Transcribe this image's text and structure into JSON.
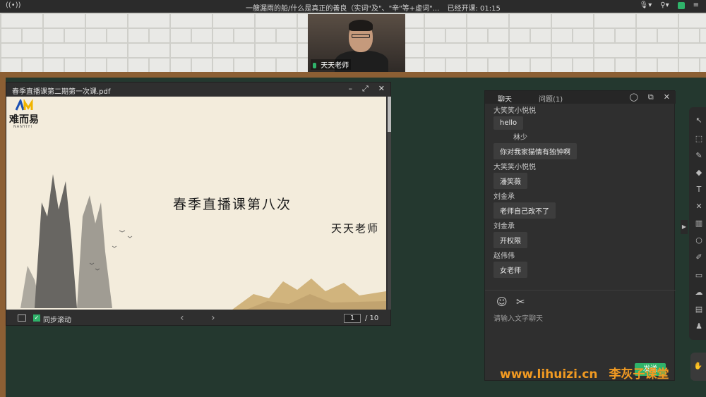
{
  "topbar": {
    "title": "一艘漏雨的船/什么是真正的善良（实词\"及\"、\"辛\"等+虚词\"...",
    "status": "已经开课: 01:15",
    "signal_icon": "broadcast-icon",
    "mic_icon": "microphone-icon",
    "location_icon": "location-icon"
  },
  "video": {
    "name": "天天老师"
  },
  "pdf": {
    "title": "春季直播课第二期第一次课.pdf",
    "slide": {
      "logo_text": "难而易",
      "logo_sub": "NANYIYI",
      "title": "春季直播课第八次",
      "teacher": "天天老师"
    },
    "sync_label": "同步滚动",
    "page_current": "1",
    "page_total": "/ 10"
  },
  "chat": {
    "tab_chat": "聊天",
    "tab_questions": "问题(1)",
    "messages": [
      {
        "sender": "大笑笑小悦悦",
        "text": "hello"
      },
      {
        "sender": "林少",
        "text": "你对我家猫情有独钟啊"
      },
      {
        "sender": "大笑笑小悦悦",
        "text": "潘笑薇"
      },
      {
        "sender": "刘金承",
        "text": "老师自己改不了"
      },
      {
        "sender": "刘金承",
        "text": "开权限"
      },
      {
        "sender": "赵伟伟",
        "text": "女老师"
      }
    ],
    "input_placeholder": "请输入文字聊天",
    "send_label": "发送"
  },
  "watermark": {
    "url": "www.lihuizi.cn",
    "brand": "李灰子课堂"
  },
  "colors": {
    "board": "#24382f",
    "frame": "#8c5f34",
    "accent_green": "#2fb36a",
    "watermark_orange": "#f19a22"
  }
}
